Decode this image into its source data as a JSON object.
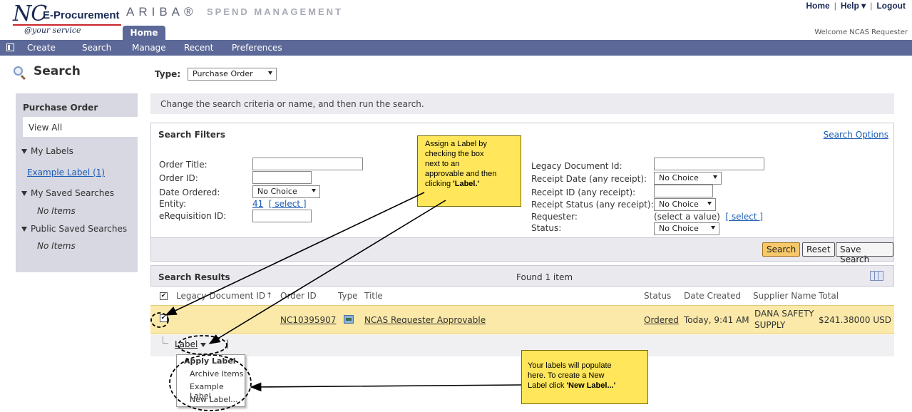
{
  "header": {
    "logo_nc": "NC",
    "logo_ep": "E-Procurement",
    "logo_tagline": "@your service",
    "ariba": "ARIBA®",
    "spend": "SPEND MANAGEMENT",
    "home_tab": "Home",
    "links": [
      "Home",
      "Help ▾",
      "Logout"
    ],
    "welcome": "Welcome NCAS Requester"
  },
  "nav": {
    "items": [
      "Create",
      "Search",
      "Manage",
      "Recent",
      "Preferences"
    ]
  },
  "left": {
    "title": "Search",
    "panel_head": "Purchase Order",
    "view_all": "View All",
    "my_labels": "My Labels",
    "example_label_link": "Example Label (1)",
    "my_saved": "My Saved Searches",
    "no_items": "No Items",
    "public_saved": "Public Saved Searches"
  },
  "type": {
    "label": "Type:",
    "value": "Purchase Order"
  },
  "instruction": "Change the search criteria or name, and then run the search.",
  "filters": {
    "title": "Search Filters",
    "options_link": "Search Options",
    "order_title": "Order Title:",
    "order_id": "Order ID:",
    "date_ordered": "Date Ordered:",
    "date_ordered_value": "No Choice",
    "entity": "Entity:",
    "entity_value": "41",
    "entity_select": "[ select ]",
    "ereq": "eRequisition ID:",
    "legacy_doc": "Legacy Document Id:",
    "receipt_date": "Receipt Date (any receipt):",
    "receipt_date_value": "No Choice",
    "receipt_id": "Receipt ID (any receipt):",
    "receipt_status": "Receipt Status (any receipt):",
    "receipt_status_value": "No Choice",
    "requester": "Requester:",
    "requester_value": "(select a value)",
    "requester_select": "[ select ]",
    "status": "Status:",
    "status_value": "No Choice",
    "btn_search": "Search",
    "btn_reset": "Reset",
    "btn_save": "Save Search"
  },
  "results": {
    "title": "Search Results",
    "found": "Found 1 item",
    "columns": {
      "legacy": "Legacy Document ID",
      "sort_arrow": "↑",
      "order_id": "Order ID",
      "type": "Type",
      "title": "Title",
      "status": "Status",
      "date_created": "Date Created",
      "supplier": "Supplier Name",
      "total": "Total"
    },
    "row": {
      "order_id": "NC10395907",
      "title": "NCAS Requester Approvable",
      "status": "Ordered",
      "date_created": "Today, 9:41 AM",
      "supplier_line1": "DANA SAFETY",
      "supplier_line2": "SUPPLY",
      "total": "$241.38000 USD"
    },
    "label_button": "Label",
    "separator": "|"
  },
  "label_menu": {
    "heading": "Apply Label",
    "items": [
      "Archive Items",
      "Example Label",
      "New Label..."
    ]
  },
  "callouts": {
    "top": {
      "line1": "Assign a Label by",
      "line2": "checking the box",
      "line3": "next to an",
      "line4": "approvable and then",
      "line5_pre": "clicking ",
      "line5_bold": "'Label.'"
    },
    "bottom": {
      "line1": "Your labels will populate",
      "line2": "here. To create a New",
      "line3_pre": "Label click ",
      "line3_bold": "'New Label...'"
    }
  },
  "colors": {
    "nav_bg": "#5c6897",
    "left_panel_bg": "#d7d8e2",
    "selected_row_bg": "#fbe9a9",
    "callout_bg": "#ffe65a",
    "primary_button": "#f7c86a",
    "link": "#1a5bb5"
  }
}
